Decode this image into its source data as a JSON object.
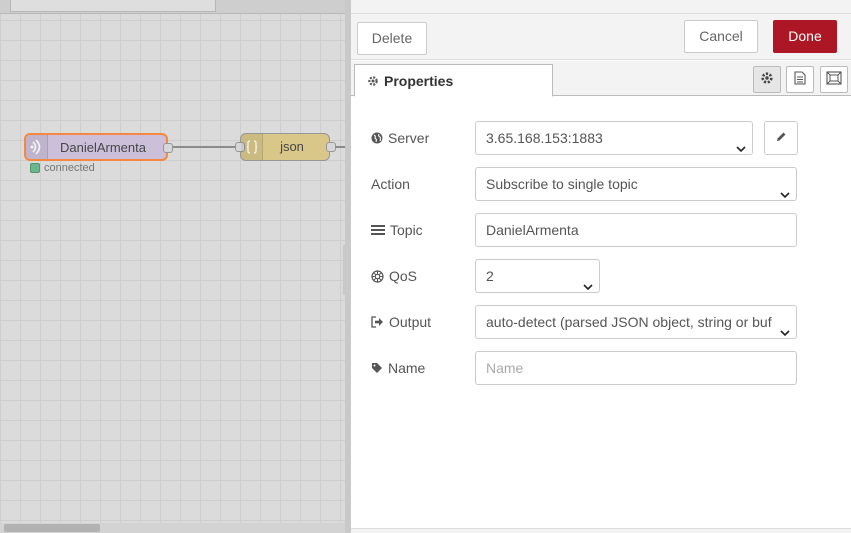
{
  "workspace": {
    "nodes": {
      "mqtt_in": {
        "label": "DanielArmenta",
        "status": "connected"
      },
      "json": {
        "label": "json"
      }
    }
  },
  "tray": {
    "toolbar": {
      "delete_label": "Delete",
      "cancel_label": "Cancel",
      "done_label": "Done"
    },
    "tabs": {
      "properties_label": "Properties"
    },
    "form": {
      "server": {
        "label": "Server",
        "value": "3.65.168.153:1883"
      },
      "action": {
        "label": "Action",
        "value": "Subscribe to single topic"
      },
      "topic": {
        "label": "Topic",
        "value": "DanielArmenta"
      },
      "qos": {
        "label": "QoS",
        "value": "2"
      },
      "output": {
        "label": "Output",
        "value": "auto-detect (parsed JSON object, string or buf"
      },
      "name": {
        "label": "Name",
        "value": "",
        "placeholder": "Name"
      }
    }
  },
  "colors": {
    "done_button": "#ad1625",
    "mqtt_node": "#d4c6e2",
    "json_node": "#e2cf8c",
    "selected_outline": "#ff8a3d",
    "status_connected": "#6cbc92"
  }
}
